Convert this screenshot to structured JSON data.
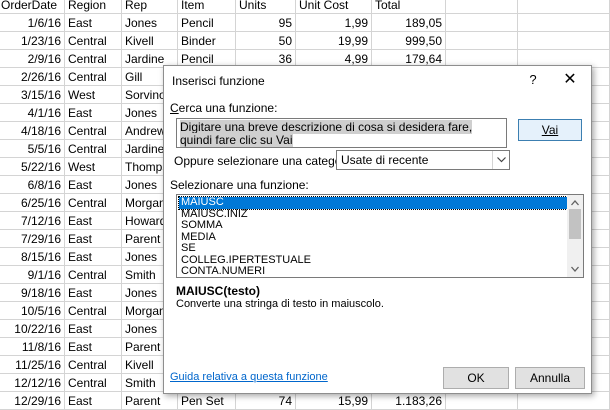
{
  "spreadsheet": {
    "headers": [
      "OrderDate",
      "Region",
      "Rep",
      "Item",
      "Units",
      "Unit Cost",
      "Total"
    ],
    "rows": [
      [
        "1/6/16",
        "East",
        "Jones",
        "Pencil",
        "95",
        "1,99",
        "189,05"
      ],
      [
        "1/23/16",
        "Central",
        "Kivell",
        "Binder",
        "50",
        "19,99",
        "999,50"
      ],
      [
        "2/9/16",
        "Central",
        "Jardine",
        "Pencil",
        "36",
        "4,99",
        "179,64"
      ],
      [
        "2/26/16",
        "Central",
        "Gill",
        "",
        "",
        "",
        ""
      ],
      [
        "3/15/16",
        "West",
        "Sorvino",
        "",
        "",
        "",
        ""
      ],
      [
        "4/1/16",
        "East",
        "Jones",
        "",
        "",
        "",
        ""
      ],
      [
        "4/18/16",
        "Central",
        "Andrews",
        "",
        "",
        "",
        ""
      ],
      [
        "5/5/16",
        "Central",
        "Jardine",
        "",
        "",
        "",
        ""
      ],
      [
        "5/22/16",
        "West",
        "Thompson",
        "",
        "",
        "",
        ""
      ],
      [
        "6/8/16",
        "East",
        "Jones",
        "",
        "",
        "",
        ""
      ],
      [
        "6/25/16",
        "Central",
        "Morgan",
        "",
        "",
        "",
        ""
      ],
      [
        "7/12/16",
        "East",
        "Howard",
        "",
        "",
        "",
        ""
      ],
      [
        "7/29/16",
        "East",
        "Parent",
        "",
        "",
        "",
        ""
      ],
      [
        "8/15/16",
        "East",
        "Jones",
        "",
        "",
        "",
        ""
      ],
      [
        "9/1/16",
        "Central",
        "Smith",
        "",
        "",
        "",
        ""
      ],
      [
        "9/18/16",
        "East",
        "Jones",
        "",
        "",
        "",
        ""
      ],
      [
        "10/5/16",
        "Central",
        "Morgan",
        "",
        "",
        "",
        ""
      ],
      [
        "10/22/16",
        "East",
        "Jones",
        "",
        "",
        "",
        ""
      ],
      [
        "11/8/16",
        "East",
        "Parent",
        "",
        "",
        "",
        ""
      ],
      [
        "11/25/16",
        "Central",
        "Kivell",
        "",
        "",
        "",
        ""
      ],
      [
        "12/12/16",
        "Central",
        "Smith",
        "",
        "",
        "",
        ""
      ],
      [
        "12/29/16",
        "East",
        "Parent",
        "Pen Set",
        "74",
        "15,99",
        "1.183,26"
      ]
    ]
  },
  "dialog": {
    "title": "Inserisci funzione",
    "help_glyph": "?",
    "close_glyph": "✕",
    "search_label": "Cerca una funzione:",
    "search_text_selected": "Digitare una breve descrizione di cosa si desidera fare, quindi fare clic su Vai",
    "go_button": "Vai",
    "category_label": "Oppure selezionare una categoria:",
    "category_value": "Usate di recente",
    "function_list_label": "Selezionare una funzione:",
    "functions": [
      "MAIUSC",
      "MAIUSC.INIZ",
      "SOMMA",
      "MEDIA",
      "SE",
      "COLLEG.IPERTESTUALE",
      "CONTA.NUMERI"
    ],
    "selected_index": 0,
    "function_signature": "MAIUSC(testo)",
    "function_description": "Converte una stringa di testo in maiuscolo.",
    "help_link": "Guida relativa a questa funzione",
    "ok_button": "OK",
    "cancel_button": "Annulla"
  },
  "icons": {
    "dropdown": "chevron-down-icon",
    "scroll_up": "chevron-up-icon",
    "scroll_down": "chevron-down-icon"
  },
  "colors": {
    "selection_blue": "#0078d7",
    "link_blue": "#0066cc",
    "grid_line": "#d4d4d4"
  }
}
